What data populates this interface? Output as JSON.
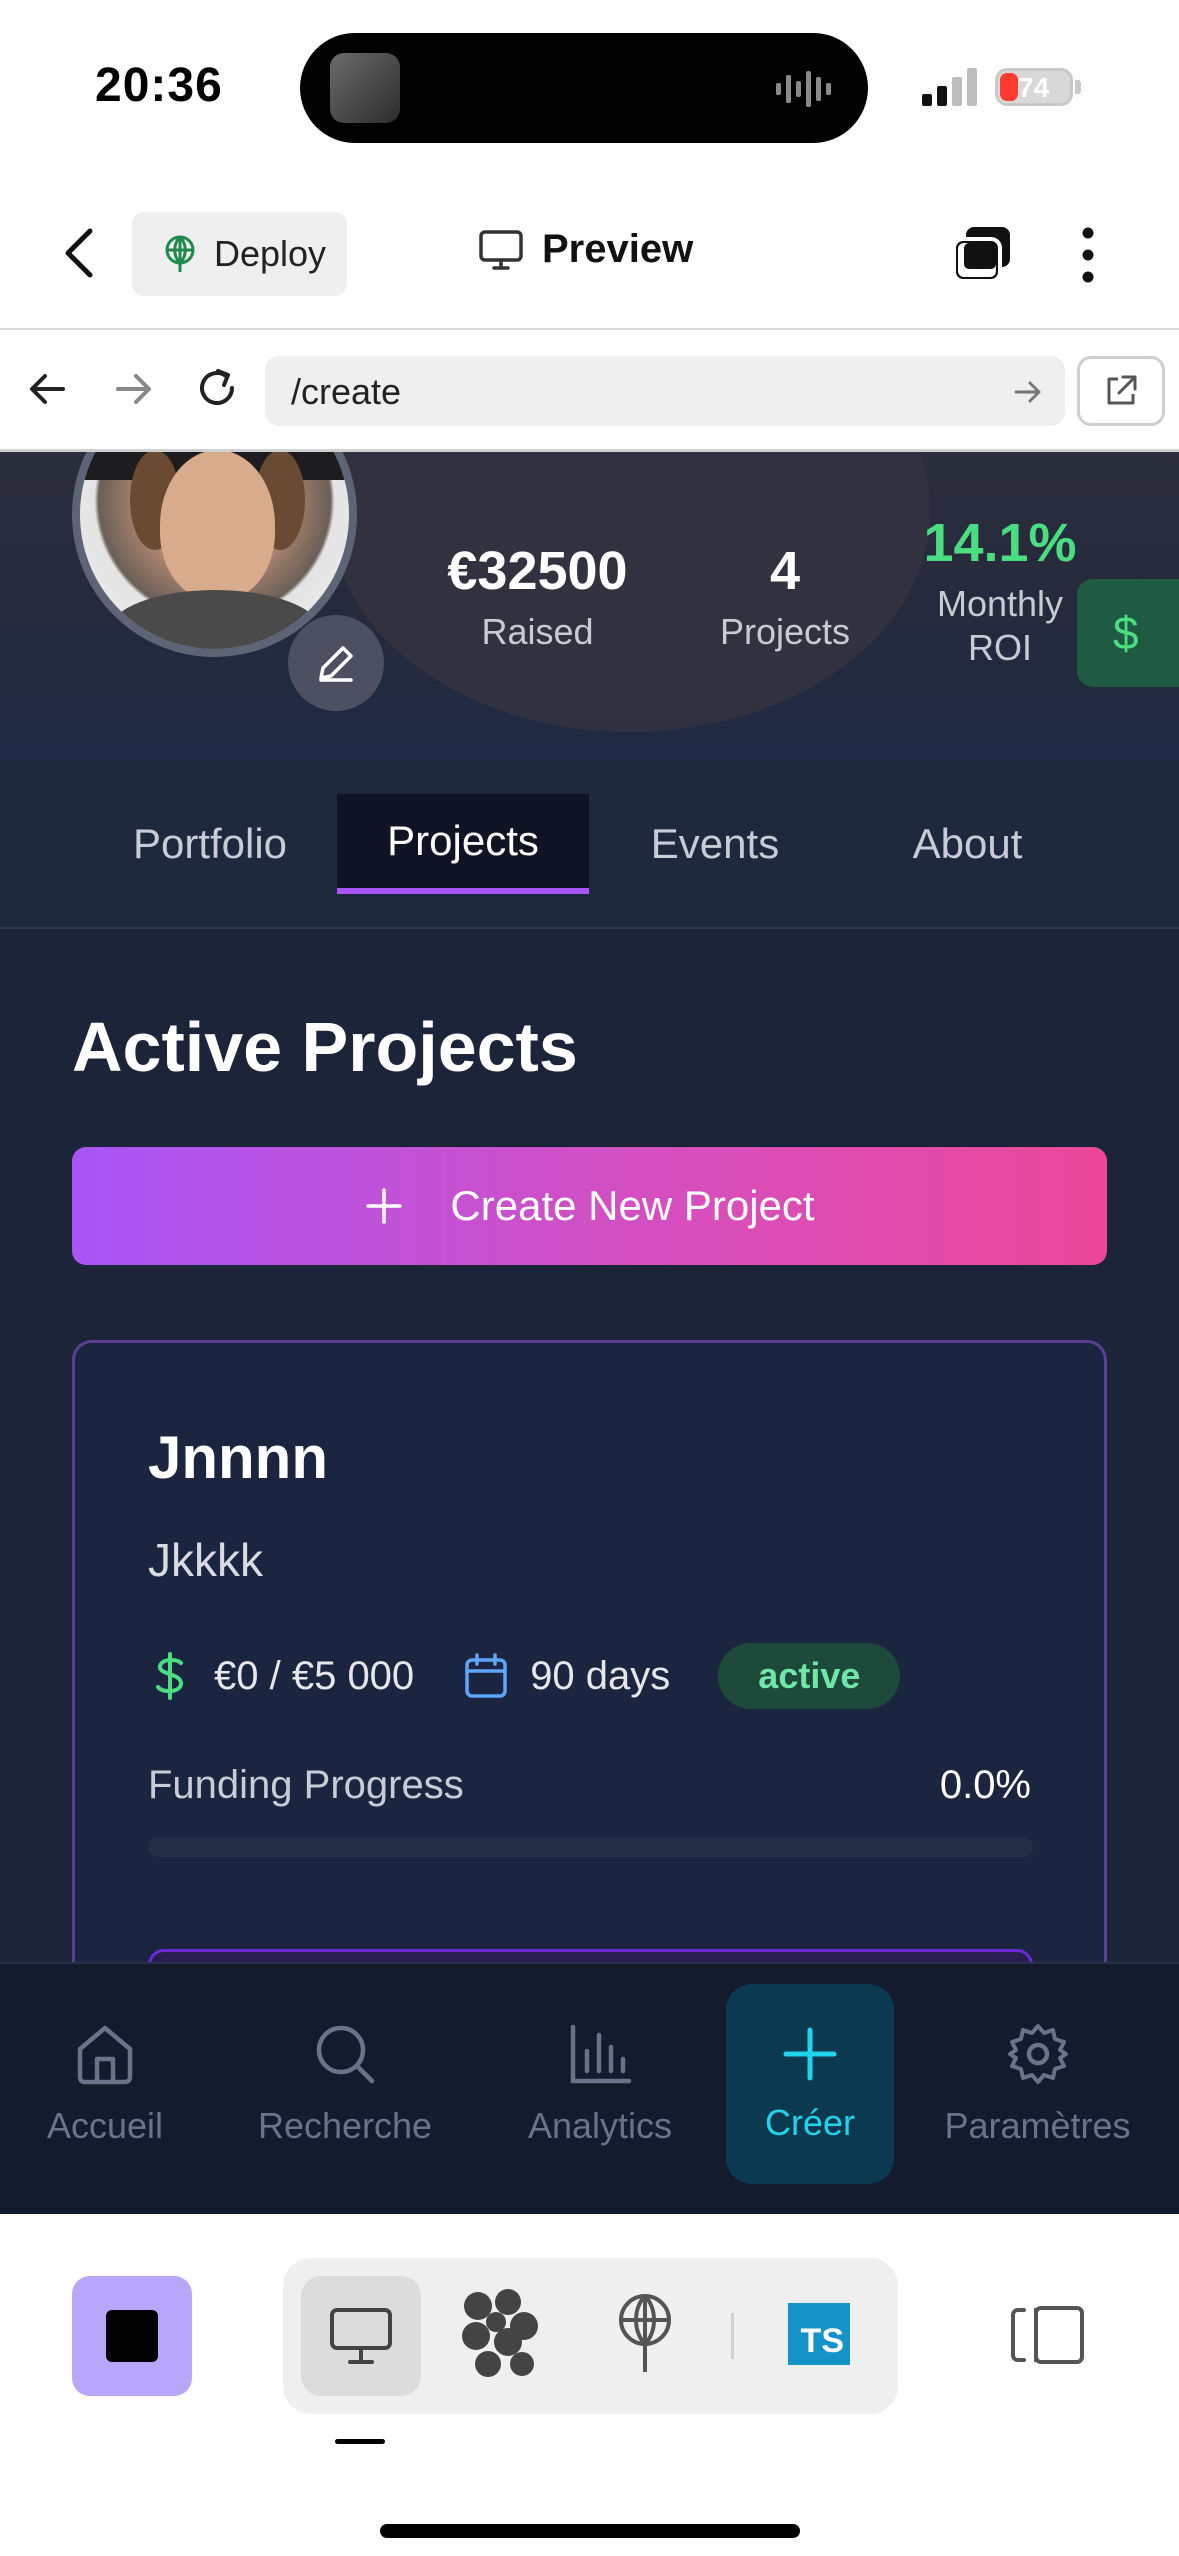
{
  "status_bar": {
    "time": "20:36",
    "battery_level": "74"
  },
  "toolbar": {
    "deploy_label": "Deploy",
    "preview_label": "Preview"
  },
  "browser": {
    "url": "/create"
  },
  "profile": {
    "stats": [
      {
        "value": "€32500",
        "label": "Raised"
      },
      {
        "value": "4",
        "label": "Projects"
      },
      {
        "value": "14.1%",
        "label": "Monthly ROI"
      }
    ],
    "fab_symbol": "$"
  },
  "tabs": [
    {
      "label": "Portfolio",
      "active": false
    },
    {
      "label": "Projects",
      "active": true
    },
    {
      "label": "Events",
      "active": false
    },
    {
      "label": "About",
      "active": false
    }
  ],
  "projects": {
    "section_title": "Active Projects",
    "create_button_label": "Create New Project",
    "card": {
      "title": "Jnnnn",
      "description": "Jkkkk",
      "funding": "€0 / €5 000",
      "duration": "90 days",
      "status": "active",
      "progress_label": "Funding Progress",
      "progress_text": "0.0%",
      "progress_fraction": 0.0
    }
  },
  "app_nav": [
    {
      "label": "Accueil",
      "icon": "home-icon",
      "active": false
    },
    {
      "label": "Recherche",
      "icon": "search-icon",
      "active": false
    },
    {
      "label": "Analytics",
      "icon": "bar-chart-icon",
      "active": false
    },
    {
      "label": "Créer",
      "icon": "plus-icon",
      "active": true
    },
    {
      "label": "Paramètres",
      "icon": "gear-icon",
      "active": false
    }
  ],
  "dock": {
    "ts_label": "TS"
  },
  "colors": {
    "accent_purple": "#a855f7",
    "accent_pink": "#ec4899",
    "success_green": "#4ade80",
    "active_cyan": "#22d3ee",
    "page_bg": "#1b2439"
  }
}
